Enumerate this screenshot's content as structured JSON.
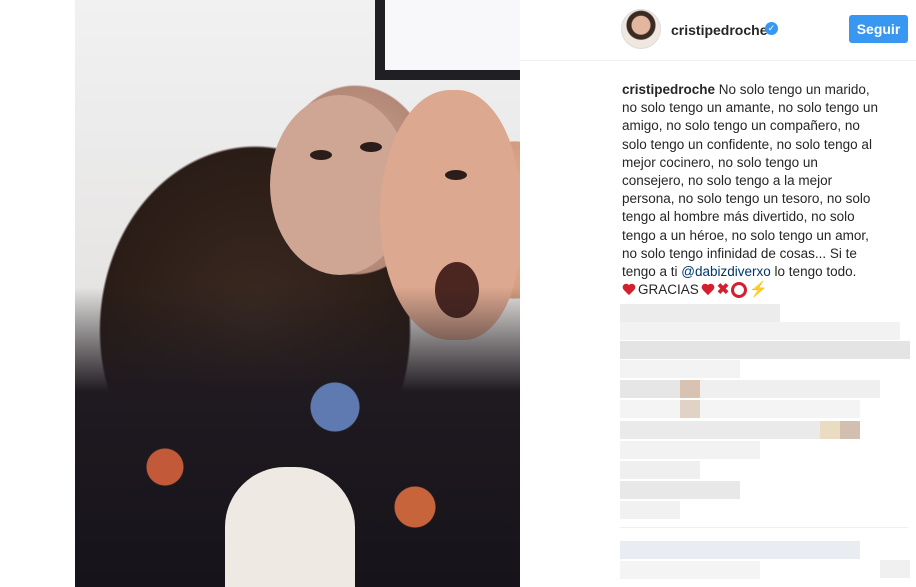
{
  "post": {
    "username": "cristipedroche",
    "verified_mark": "✓",
    "follow_label": "Seguir",
    "caption_user": "cristipedroche",
    "caption_lines": [
      " No solo tengo un marido,",
      "no solo tengo un amante, no solo tengo un",
      "amigo, no solo tengo un compañero, no",
      "solo tengo un confidente, no solo tengo al",
      "mejor cocinero, no solo tengo un",
      "consejero, no solo tengo a la mejor",
      "persona, no solo tengo un tesoro, no solo",
      "tengo al hombre más divertido, no solo",
      "tengo a un héroe, no solo tengo un amor,",
      "no solo tengo infinidad de cosas... Si te"
    ],
    "last_line_prefix": "tengo a ti ",
    "mention": "@dabizdiverxo",
    "last_line_suffix": " lo tengo todo.",
    "gracias": "GRACIAS",
    "emoji_icons": [
      "heart-icon",
      "heart-icon",
      "cross-mark-icon",
      "circle-icon",
      "lightning-icon"
    ]
  },
  "colors": {
    "accent": "#3897f0",
    "text": "#262626",
    "mention": "#003569",
    "emoji_red": "#d3202f",
    "emoji_yellow": "#f5b400"
  }
}
